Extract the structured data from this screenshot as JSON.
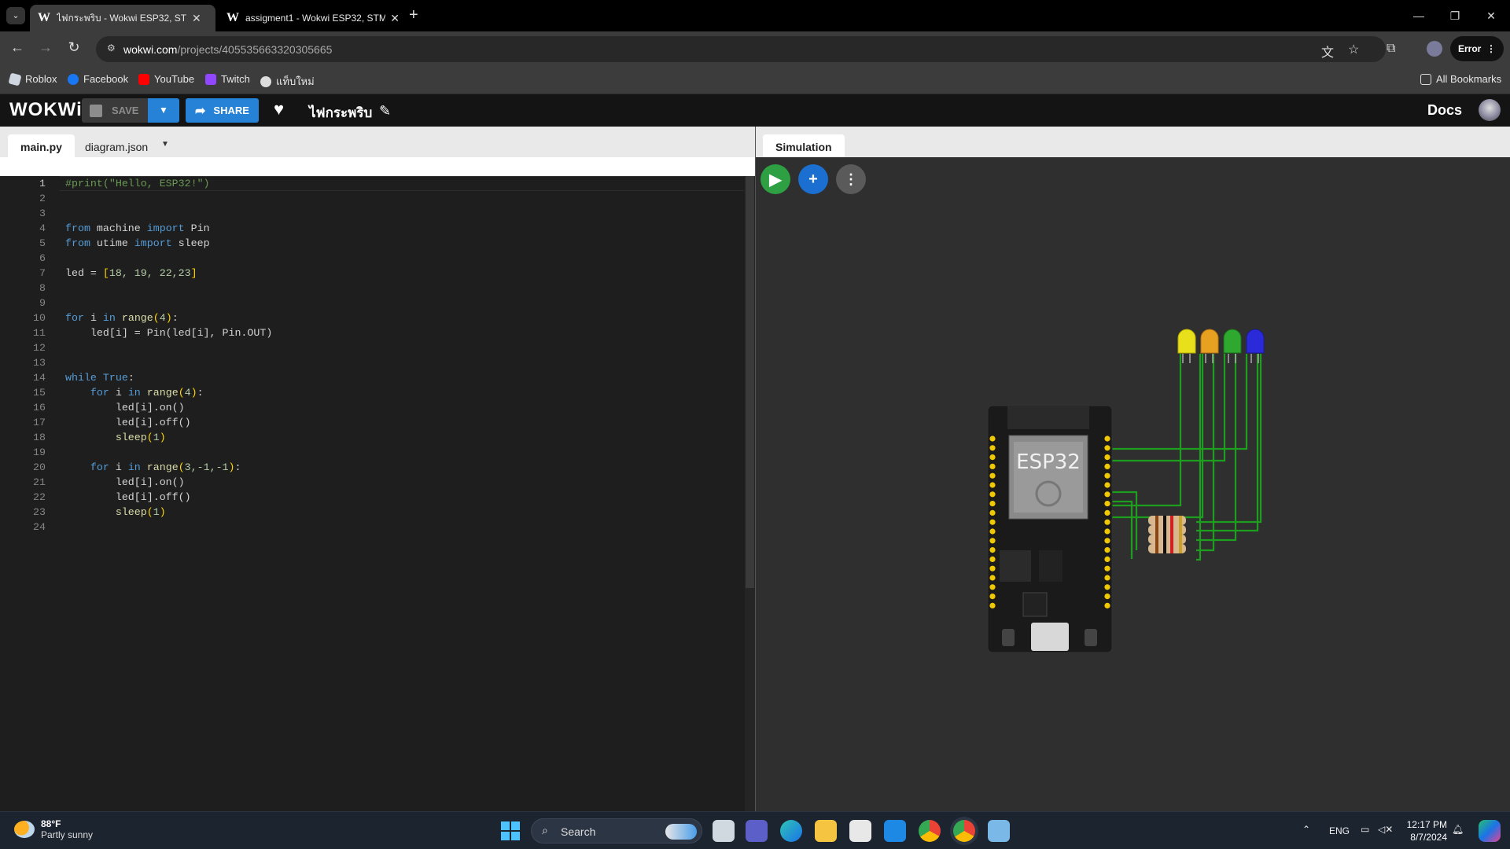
{
  "browser": {
    "tabs": [
      {
        "title": "ไฟกระพริบ - Wokwi ESP32, STM3",
        "active": true
      },
      {
        "title": "assigment1 - Wokwi ESP32, STM",
        "active": false
      }
    ],
    "url_host": "wokwi.com",
    "url_path": "/projects/405535663320305665",
    "profile_label": "Error",
    "bookmarks": [
      "Roblox",
      "Facebook",
      "YouTube",
      "Twitch",
      "แท็บใหม่"
    ],
    "all_bookmarks": "All Bookmarks"
  },
  "wokwi": {
    "logo": "WOKWi",
    "save_label": "SAVE",
    "share_label": "SHARE",
    "project_name": "ไฟกระพริบ",
    "docs_label": "Docs"
  },
  "editor": {
    "tabs": [
      "main.py",
      "diagram.json"
    ],
    "line_numbers": [
      "1",
      "2",
      "3",
      "4",
      "5",
      "6",
      "7",
      "8",
      "9",
      "10",
      "11",
      "12",
      "13",
      "14",
      "15",
      "16",
      "17",
      "18",
      "19",
      "20",
      "21",
      "22",
      "23",
      "24"
    ]
  },
  "simulation": {
    "tab_label": "Simulation",
    "board_label": "ESP32",
    "led_colors": [
      "#e8e01a",
      "#e8a020",
      "#2ea82e",
      "#2a2ad8"
    ],
    "wire_color": "#1e9e1e"
  },
  "taskbar": {
    "weather_temp": "88°F",
    "weather_desc": "Partly sunny",
    "search_label": "Search",
    "language": "ENG",
    "time": "12:17 PM",
    "date": "8/7/2024"
  }
}
